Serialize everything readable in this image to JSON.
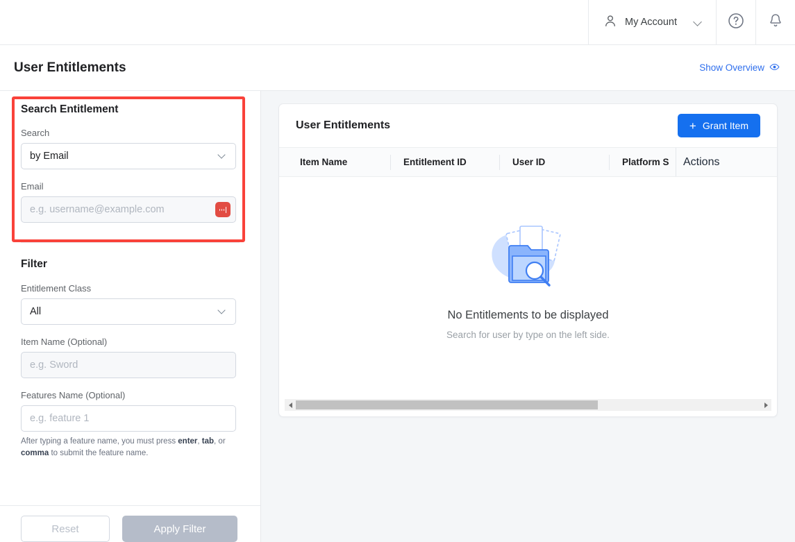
{
  "topbar": {
    "account_label": "My Account",
    "account_icon": "user-avatar-icon",
    "chevron_icon": "chevron-down-icon",
    "help_icon": "help-circle-icon",
    "bell_icon": "notification-bell-icon"
  },
  "header": {
    "page_title": "User Entitlements",
    "overview_link": "Show Overview",
    "overview_icon": "eye-icon",
    "link_color": "#2f6fed"
  },
  "sidebar": {
    "search_section": {
      "title": "Search Entitlement",
      "search_label": "Search",
      "search_value": "by Email",
      "email_label": "Email",
      "email_value": "",
      "email_placeholder": "e.g. username@example.com",
      "loading_icon": "ellipsis-loading-icon",
      "loading_color": "#e24c43",
      "highlight_color": "#f9423a"
    },
    "filter_section": {
      "title": "Filter",
      "entitlement_class_label": "Entitlement Class",
      "entitlement_class_value": "All",
      "item_name_label": "Item Name (Optional)",
      "item_name_value": "",
      "item_name_placeholder": "e.g. Sword",
      "features_name_label": "Features Name (Optional)",
      "features_name_value": "",
      "features_name_placeholder": "e.g. feature 1",
      "hint_prefix": "After typing a feature name, you must press ",
      "hint_key1": "enter",
      "hint_sep1": ", ",
      "hint_key2": "tab",
      "hint_sep2": ", or ",
      "hint_key3": "comma",
      "hint_suffix": " to submit the feature name."
    },
    "footer": {
      "reset_label": "Reset",
      "apply_label": "Apply Filter"
    }
  },
  "main": {
    "card_title": "User Entitlements",
    "grant_button_label": "Grant Item",
    "grant_button_icon": "plus-icon",
    "grant_button_color": "#1570ef",
    "table": {
      "columns": [
        "Item Name",
        "Entitlement ID",
        "User ID",
        "Platform S",
        "Actions"
      ]
    },
    "empty_state": {
      "illustration": "folder-search-empty-icon",
      "title": "No Entitlements to be displayed",
      "subtitle": "Search for user by type on the left side."
    },
    "scrollbar": {
      "left_arrow_icon": "scroll-left-arrow-icon",
      "right_arrow_icon": "scroll-right-arrow-icon"
    }
  }
}
